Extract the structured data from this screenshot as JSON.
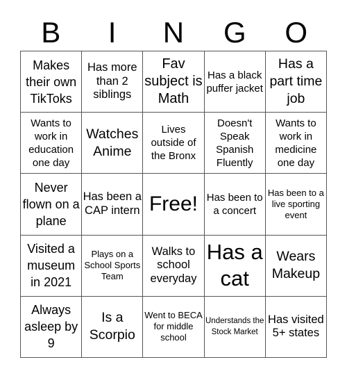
{
  "header": {
    "letters": [
      "B",
      "I",
      "N",
      "G",
      "O"
    ]
  },
  "board": {
    "rows": [
      [
        "Makes their own TikToks",
        "Has more than 2 siblings",
        "Fav subject is Math",
        "Has a black puffer jacket",
        "Has a part time job"
      ],
      [
        "Wants to work in education one day",
        "Watches Anime",
        "Lives outside of the Bronx",
        "Doesn't Speak Spanish Fluently",
        "Wants to work in medicine one day"
      ],
      [
        "Never flown on a plane",
        "Has been a CAP intern",
        "Free!",
        "Has been to a concert",
        "Has been to a live sporting event"
      ],
      [
        "Visited a museum in 2021",
        "Plays on a School Sports Team",
        "Walks to school everyday",
        "Has a cat",
        "Wears Makeup"
      ],
      [
        "Always asleep by 9",
        "Is a Scorpio",
        "Went to BECA for middle school",
        "Understands the Stock Market",
        "Has visited 5+ states"
      ]
    ]
  }
}
